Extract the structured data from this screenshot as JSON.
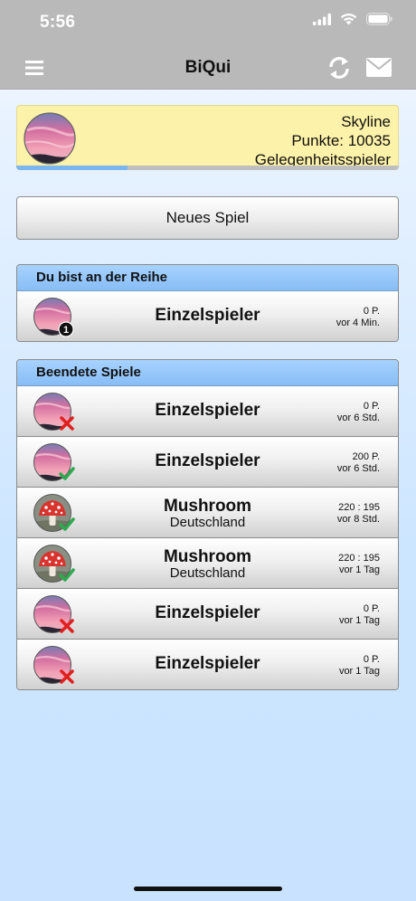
{
  "status_bar": {
    "time": "5:56"
  },
  "nav": {
    "title": "BiQui",
    "icons": [
      "menu-icon",
      "refresh-icon",
      "mail-icon"
    ]
  },
  "profile": {
    "name": "Skyline",
    "points": "Punkte: 10035",
    "level": "Gelegenheitsspieler",
    "progress_fraction": 0.29
  },
  "new_game": {
    "label": "Neues Spiel"
  },
  "your_turn": {
    "header": "Du bist an der Reihe",
    "rows": [
      {
        "title": "Einzelspieler",
        "subtitle": "",
        "score": "0 P.",
        "time": "vor 4 Min.",
        "badge": "1",
        "avatar": "sunset"
      }
    ]
  },
  "finished": {
    "header": "Beendete Spiele",
    "rows": [
      {
        "title": "Einzelspieler",
        "subtitle": "",
        "score": "0 P.",
        "time": "vor 6 Std.",
        "result": "lost",
        "avatar": "sunset"
      },
      {
        "title": "Einzelspieler",
        "subtitle": "",
        "score": "200 P.",
        "time": "vor 6 Std.",
        "result": "won",
        "avatar": "sunset"
      },
      {
        "title": "Mushroom",
        "subtitle": "Deutschland",
        "score": "220 : 195",
        "time": "vor 8 Std.",
        "result": "won",
        "avatar": "mushroom"
      },
      {
        "title": "Mushroom",
        "subtitle": "Deutschland",
        "score": "220 : 195",
        "time": "vor 1 Tag",
        "result": "won",
        "avatar": "mushroom"
      },
      {
        "title": "Einzelspieler",
        "subtitle": "",
        "score": "0 P.",
        "time": "vor 1 Tag",
        "result": "lost",
        "avatar": "sunset"
      },
      {
        "title": "Einzelspieler",
        "subtitle": "",
        "score": "0 P.",
        "time": "vor 1 Tag",
        "result": "lost",
        "avatar": "sunset"
      }
    ]
  },
  "colors": {
    "nav_bg": "#b9b9b9",
    "profile_bg": "#fdf2a9",
    "section_header": "#95c6fa",
    "progress": "#7bb6ee",
    "win": "#2fa84f",
    "loss": "#e02020"
  }
}
